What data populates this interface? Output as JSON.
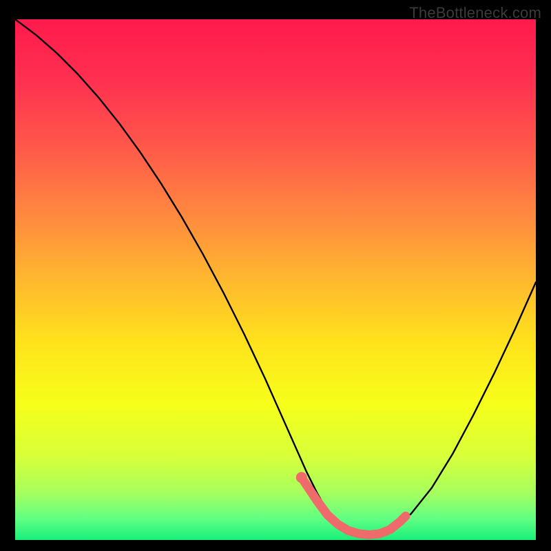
{
  "attribution": "TheBottleneck.com",
  "chart_data": {
    "type": "line",
    "title": "",
    "xlabel": "",
    "ylabel": "",
    "xlim": [
      0,
      100
    ],
    "ylim": [
      0,
      100
    ],
    "grid": false,
    "series": [
      {
        "name": "bottleneck-curve",
        "x": [
          0,
          4,
          8,
          12,
          16,
          20,
          24,
          28,
          32,
          36,
          40,
          44,
          48,
          52,
          54,
          56,
          58,
          60,
          62,
          64,
          66,
          68,
          70,
          72,
          76,
          80,
          84,
          88,
          92,
          96,
          100
        ],
        "y": [
          100,
          97,
          93.5,
          89.5,
          85,
          80,
          74.5,
          68.5,
          62,
          55,
          47.5,
          39.5,
          31,
          22,
          17.5,
          13,
          9,
          5.5,
          3,
          1.5,
          1,
          1,
          1.2,
          2,
          5,
          10,
          16.5,
          24,
          32,
          40.5,
          49.5
        ]
      },
      {
        "name": "highlight-segment",
        "x": [
          55,
          56,
          58,
          60,
          62,
          64,
          66,
          68,
          70,
          72,
          73,
          74,
          75
        ],
        "y": [
          12,
          10.5,
          7.5,
          4.8,
          3,
          1.8,
          1.2,
          1,
          1.2,
          2,
          2.8,
          3.6,
          4.6
        ]
      },
      {
        "name": "highlight-dot",
        "x": [
          55
        ],
        "y": [
          12
        ]
      }
    ],
    "background": {
      "type": "vertical-gradient",
      "stops": [
        {
          "offset": 0.0,
          "color": "#ff1a4d"
        },
        {
          "offset": 0.12,
          "color": "#ff3150"
        },
        {
          "offset": 0.25,
          "color": "#ff5a4a"
        },
        {
          "offset": 0.38,
          "color": "#ff8a3f"
        },
        {
          "offset": 0.5,
          "color": "#ffb82f"
        },
        {
          "offset": 0.62,
          "color": "#ffe21c"
        },
        {
          "offset": 0.74,
          "color": "#f6ff1a"
        },
        {
          "offset": 0.84,
          "color": "#d7ff3a"
        },
        {
          "offset": 0.91,
          "color": "#a6ff5e"
        },
        {
          "offset": 0.96,
          "color": "#5fff84"
        },
        {
          "offset": 1.0,
          "color": "#18f07a"
        }
      ]
    },
    "colors": {
      "curve": "#000000",
      "highlight": "#ef6b6b"
    }
  }
}
